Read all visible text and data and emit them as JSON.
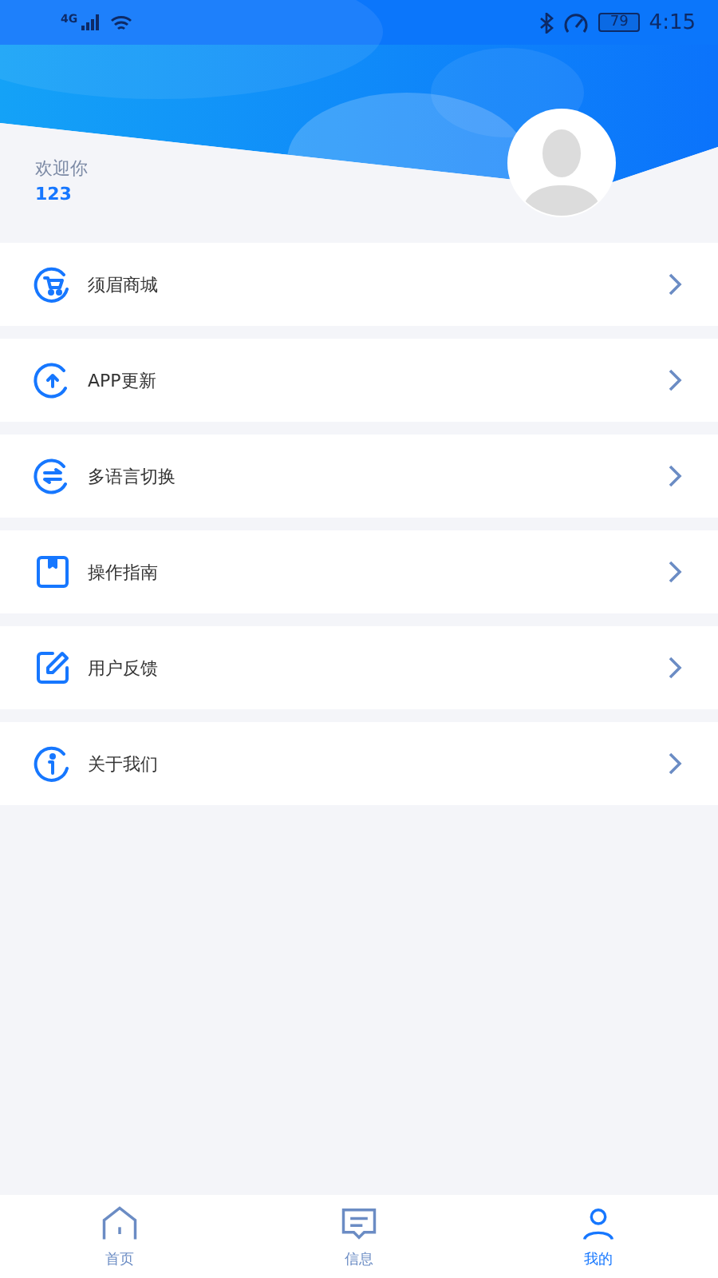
{
  "status_bar": {
    "network": "4G",
    "battery": "79",
    "time": "4:15"
  },
  "profile": {
    "greeting": "欢迎你",
    "username": "123"
  },
  "menu": [
    {
      "kind": "cart",
      "label": "须眉商城"
    },
    {
      "kind": "update",
      "label": "APP更新"
    },
    {
      "kind": "language",
      "label": "多语言切换"
    },
    {
      "kind": "guide",
      "label": "操作指南"
    },
    {
      "kind": "feedback",
      "label": "用户反馈"
    },
    {
      "kind": "about",
      "label": "关于我们"
    }
  ],
  "tab_bar": [
    {
      "kind": "home",
      "label": "首页",
      "selected": false
    },
    {
      "kind": "messages",
      "label": "信息",
      "selected": false
    },
    {
      "kind": "me",
      "label": "我的",
      "selected": true
    }
  ]
}
